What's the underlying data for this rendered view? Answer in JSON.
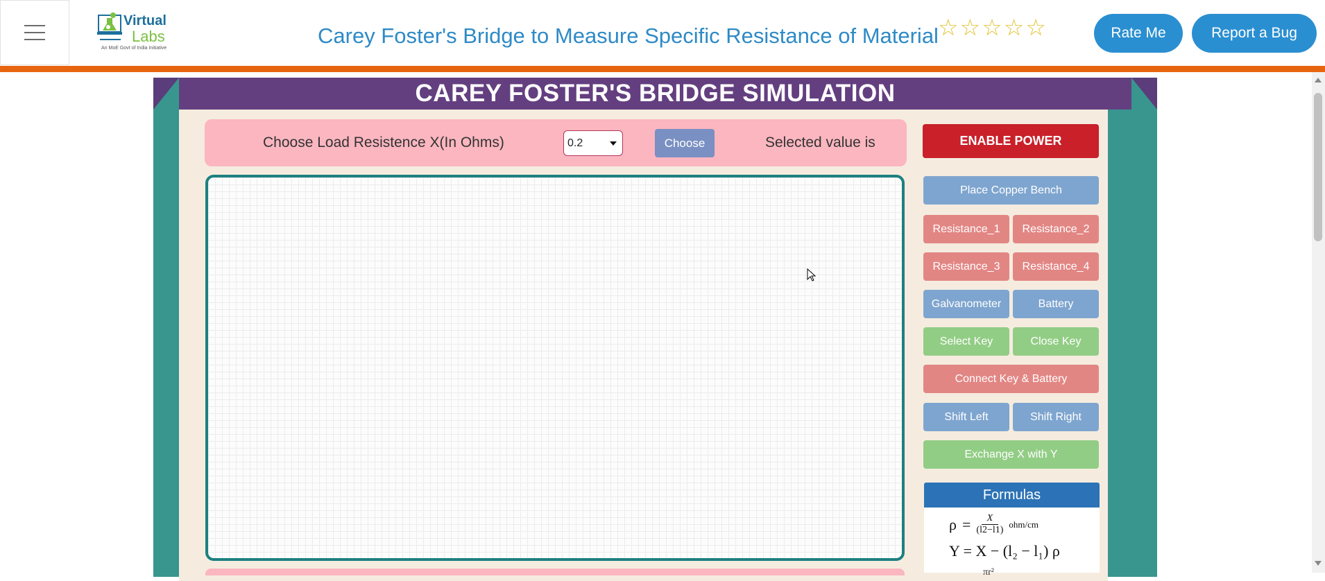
{
  "header": {
    "logo_line1": "Virtual",
    "logo_line2": "Labs",
    "logo_tagline": "An MoE Govt of India Initiative",
    "title": "Carey Foster's Bridge to Measure Specific Resistance of Material",
    "stars": [
      "☆",
      "☆",
      "☆",
      "☆",
      "☆"
    ],
    "rate_label": "Rate Me",
    "bug_label": "Report a Bug"
  },
  "simulation": {
    "title": "CAREY FOSTER'S BRIDGE SIMULATION",
    "choose_label": "Choose Load Resistence X(In Ohms)",
    "select_value": "0.2",
    "choose_button": "Choose",
    "selected_label": "Selected value is"
  },
  "controls": {
    "enable_power": "ENABLE POWER",
    "place_copper_bench": "Place Copper Bench",
    "resistance_1": "Resistance_1",
    "resistance_2": "Resistance_2",
    "resistance_3": "Resistance_3",
    "resistance_4": "Resistance_4",
    "galvanometer": "Galvanometer",
    "battery": "Battery",
    "select_key": "Select Key",
    "close_key": "Close Key",
    "connect_key_battery": "Connect Key & Battery",
    "shift_left": "Shift Left",
    "shift_right": "Shift Right",
    "exchange": "Exchange X with Y"
  },
  "formulas": {
    "heading": "Formulas",
    "rho_symbol": "ρ",
    "equals": "=",
    "rho_numerator": "X",
    "rho_denominator": "(l2−l1)",
    "rho_unit": "ohm/cm",
    "y_formula": "Y  =  X − (l₂ − l₁) ρ",
    "partial_line": "πr²"
  },
  "colors": {
    "accent_orange": "#e8650f",
    "title_purple": "#643f80",
    "frame_teal": "#38968f",
    "power_red": "#c9202a",
    "button_blue": "#7ea5cf",
    "button_red": "#e28684",
    "button_green": "#92cd85",
    "header_blue": "#2e8ac6"
  }
}
